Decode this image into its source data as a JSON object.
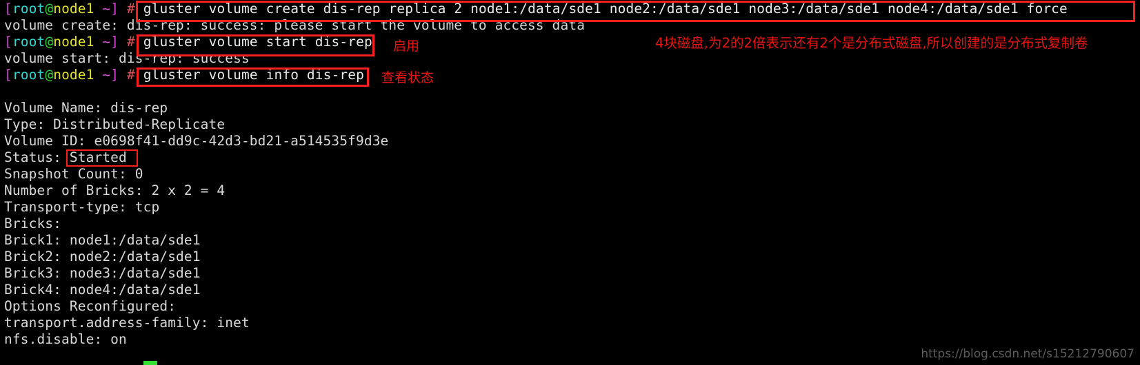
{
  "terminal": {
    "background_color": "#000000",
    "prompt": {
      "open_bracket": "[",
      "user": "root",
      "at": "@",
      "host": "node1",
      "space_tilde": " ~",
      "close_bracket": "]",
      "hash": " # "
    },
    "lines": [
      {
        "id": "cmd1",
        "type": "command",
        "text": "gluster volume create dis-rep replica 2 node1:/data/sde1 node2:/data/sde1 node3:/data/sde1 node4:/data/sde1 force"
      },
      {
        "id": "out1",
        "type": "output",
        "text": "volume create: dis-rep: success: please start the volume to access data"
      },
      {
        "id": "cmd2",
        "type": "command",
        "text": "gluster volume start dis-rep"
      },
      {
        "id": "out2",
        "type": "output",
        "text": "volume start: dis-rep: success"
      },
      {
        "id": "cmd3",
        "type": "command",
        "text": "gluster volume info dis-rep"
      },
      {
        "id": "blank1",
        "type": "output",
        "text": ""
      },
      {
        "id": "info1",
        "type": "output",
        "text": "Volume Name: dis-rep"
      },
      {
        "id": "info2",
        "type": "output",
        "text": "Type: Distributed-Replicate"
      },
      {
        "id": "info3",
        "type": "output",
        "text": "Volume ID: e0698f41-dd9c-42d3-bd21-a514535f9d3e"
      },
      {
        "id": "info4",
        "type": "output",
        "text": "Status: Started"
      },
      {
        "id": "info5",
        "type": "output",
        "text": "Snapshot Count: 0"
      },
      {
        "id": "info6",
        "type": "output",
        "text": "Number of Bricks: 2 x 2 = 4"
      },
      {
        "id": "info7",
        "type": "output",
        "text": "Transport-type: tcp"
      },
      {
        "id": "info8",
        "type": "output",
        "text": "Bricks:"
      },
      {
        "id": "info9",
        "type": "output",
        "text": "Brick1: node1:/data/sde1"
      },
      {
        "id": "info10",
        "type": "output",
        "text": "Brick2: node2:/data/sde1"
      },
      {
        "id": "info11",
        "type": "output",
        "text": "Brick3: node3:/data/sde1"
      },
      {
        "id": "info12",
        "type": "output",
        "text": "Brick4: node4:/data/sde1"
      },
      {
        "id": "info13",
        "type": "output",
        "text": "Options Reconfigured:"
      },
      {
        "id": "info14",
        "type": "output",
        "text": "transport.address-family: inet"
      },
      {
        "id": "info15",
        "type": "output",
        "text": "nfs.disable: on"
      }
    ],
    "volume_info": {
      "volume_name": "dis-rep",
      "type": "Distributed-Replicate",
      "volume_id": "e0698f41-dd9c-42d3-bd21-a514535f9d3e",
      "status": "Started",
      "snapshot_count": "0",
      "number_of_bricks": "2 x 2 = 4",
      "transport_type": "tcp",
      "bricks": [
        "node1:/data/sde1",
        "node2:/data/sde1",
        "node3:/data/sde1",
        "node4:/data/sde1"
      ],
      "options_reconfigured": {
        "transport_address_family": "inet",
        "nfs_disable": "on"
      }
    }
  },
  "annotations": {
    "highlight_color": "#fa1f1f",
    "label_create_note": "4块磁盘,为2的2倍表示还有2个是分布式磁盘,所以创建的是分布式复制卷",
    "label_start": "启用",
    "label_info": "查看状态"
  },
  "cursor": {
    "color": "#33e033"
  },
  "watermark": {
    "text": "https://blog.csdn.net/s15212790607",
    "color": "#5c5c5c"
  }
}
